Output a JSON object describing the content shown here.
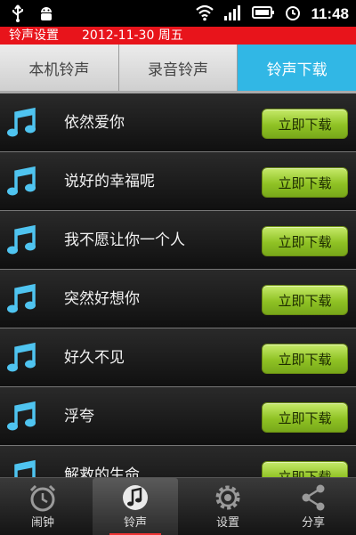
{
  "statusbar": {
    "time": "11:48",
    "icons": [
      "usb-icon",
      "android-debug-icon",
      "wifi-icon",
      "signal-icon",
      "battery-icon",
      "alarm-icon"
    ]
  },
  "header": {
    "title": "铃声设置",
    "date": "2012-11-30 周五"
  },
  "tabs": [
    {
      "label": "本机铃声",
      "active": false
    },
    {
      "label": "录音铃声",
      "active": false
    },
    {
      "label": "铃声下载",
      "active": true
    }
  ],
  "ringtones": [
    {
      "title": "依然爱你",
      "button": "立即下载"
    },
    {
      "title": "说好的幸福呢",
      "button": "立即下载"
    },
    {
      "title": "我不愿让你一个人",
      "button": "立即下载"
    },
    {
      "title": "突然好想你",
      "button": "立即下载"
    },
    {
      "title": "好久不见",
      "button": "立即下载"
    },
    {
      "title": "浮夸",
      "button": "立即下载"
    },
    {
      "title": "解救的生命",
      "button": "立即下载"
    }
  ],
  "bottomnav": [
    {
      "label": "闹钟",
      "icon": "alarm-clock-icon",
      "active": false
    },
    {
      "label": "铃声",
      "icon": "ringtone-icon",
      "active": true
    },
    {
      "label": "设置",
      "icon": "gear-icon",
      "active": false
    },
    {
      "label": "分享",
      "icon": "share-icon",
      "active": false
    }
  ],
  "colors": {
    "header_red": "#e8141b",
    "tab_active": "#31b7e5",
    "download_green": "#8fc224",
    "note_blue": "#4fc4f0"
  }
}
